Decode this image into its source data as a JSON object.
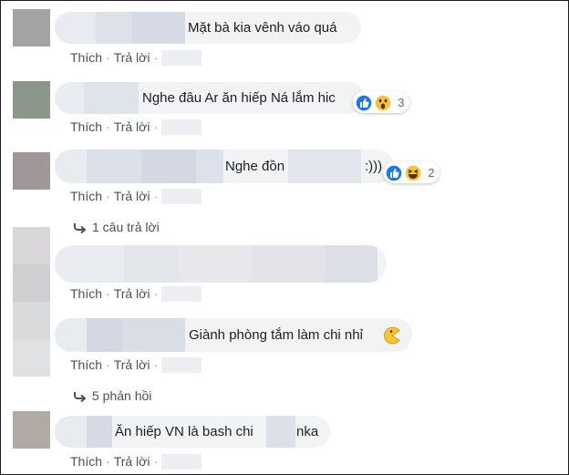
{
  "actions": {
    "like": "Thích",
    "separator": "·",
    "reply": "Trả lời"
  },
  "comments": [
    {
      "text": "Mặt bà kia vênh váo quá"
    },
    {
      "text": "Nghe đâu Ar ăn hiếp Ná lắm hic",
      "reaction_count": "3",
      "reactions": [
        "like-icon",
        "wow-icon"
      ]
    },
    {
      "text": "Nghe đồn",
      "text_suffix": ":)))",
      "reaction_count": "2",
      "reactions": [
        "like-icon",
        "haha-icon"
      ]
    },
    {
      "text": ""
    },
    {
      "text": "Giành phòng tắm làm chi nhỉ",
      "emoji": "pacman-emoji"
    },
    {
      "text": "Ăn hiếp VN là bash chi",
      "text_suffix": "nka"
    }
  ],
  "reply_links": [
    "1 câu trả lời",
    "5 phản hồi"
  ],
  "colors": {
    "bubble": "#f2f3f5",
    "like_blue": "#1877f2",
    "reaction_yellow": "#f7c531",
    "text": "#1c1e21",
    "meta": "#4b4f56"
  }
}
